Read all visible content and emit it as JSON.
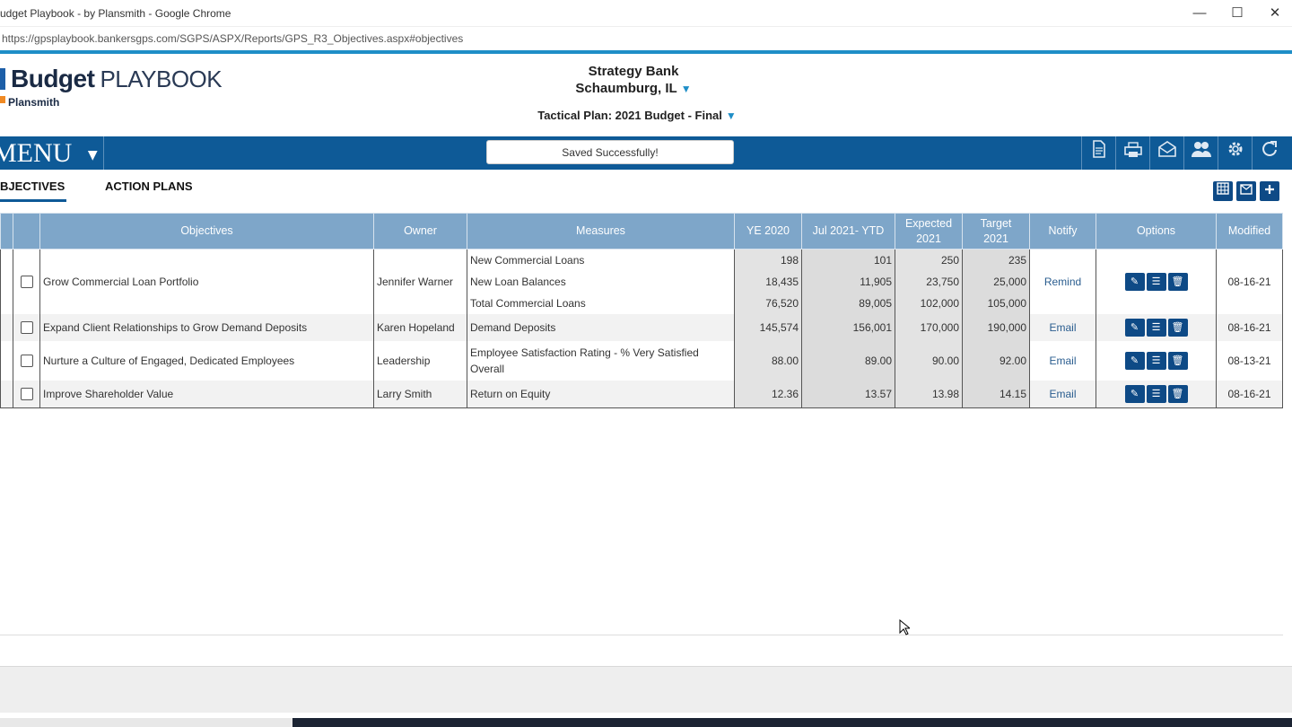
{
  "browser": {
    "window_title": "udget Playbook - by Plansmith - Google Chrome",
    "url": "https://gpsplaybook.bankersgps.com/SGPS/ASPX/Reports/GPS_R3_Objectives.aspx#objectives",
    "minimize": "—",
    "maximize": "☐",
    "close": "✕"
  },
  "header": {
    "logo_bold": "Budget",
    "logo_light": "PLAYBOOK",
    "logo_sub": "Plansmith",
    "bank_name": "Strategy Bank",
    "bank_location": "Schaumburg, IL",
    "plan": "Tactical Plan: 2021 Budget - Final",
    "caret": "▼"
  },
  "nav": {
    "menu_label": "MENU",
    "menu_chevron": "▼",
    "toast": "Saved Successfully!",
    "icons": [
      "report-icon",
      "print-icon",
      "mail-icon",
      "users-icon",
      "gear-icon",
      "refresh-icon"
    ]
  },
  "tabs": {
    "objectives": "BJECTIVES",
    "action_plans": "ACTION PLANS"
  },
  "table": {
    "headers": {
      "objectives": "Objectives",
      "owner": "Owner",
      "measures": "Measures",
      "ye2020": "YE 2020",
      "jul_ytd": "Jul 2021- YTD",
      "expected_1": "Expected",
      "expected_2": "2021",
      "target_1": "Target",
      "target_2": "2021",
      "notify": "Notify",
      "options": "Options",
      "modified": "Modified"
    },
    "rows": [
      {
        "objective": "Grow Commercial Loan Portfolio",
        "owner": "Jennifer Warner",
        "notify": "Remind",
        "modified": "08-16-21",
        "measures": [
          {
            "name": "New Commercial Loans",
            "ye2020": "198",
            "ytd": "101",
            "expected": "250",
            "target": "235"
          },
          {
            "name": "New Loan Balances",
            "ye2020": "18,435",
            "ytd": "11,905",
            "expected": "23,750",
            "target": "25,000"
          },
          {
            "name": "Total Commercial Loans",
            "ye2020": "76,520",
            "ytd": "89,005",
            "expected": "102,000",
            "target": "105,000"
          }
        ]
      },
      {
        "objective": "Expand Client Relationships to Grow Demand Deposits",
        "owner": "Karen Hopeland",
        "notify": "Email",
        "modified": "08-16-21",
        "measures": [
          {
            "name": "Demand Deposits",
            "ye2020": "145,574",
            "ytd": "156,001",
            "expected": "170,000",
            "target": "190,000"
          }
        ]
      },
      {
        "objective": "Nurture a Culture of Engaged, Dedicated Employees",
        "owner": "Leadership",
        "notify": "Email",
        "modified": "08-13-21",
        "measures": [
          {
            "name": "Employee Satisfaction Rating - % Very Satisfied Overall",
            "ye2020": "88.00",
            "ytd": "89.00",
            "expected": "90.00",
            "target": "92.00"
          }
        ]
      },
      {
        "objective": "Improve Shareholder Value",
        "owner": "Larry Smith",
        "notify": "Email",
        "modified": "08-16-21",
        "measures": [
          {
            "name": "Return on Equity",
            "ye2020": "12.36",
            "ytd": "13.57",
            "expected": "13.98",
            "target": "14.15"
          }
        ]
      }
    ]
  }
}
